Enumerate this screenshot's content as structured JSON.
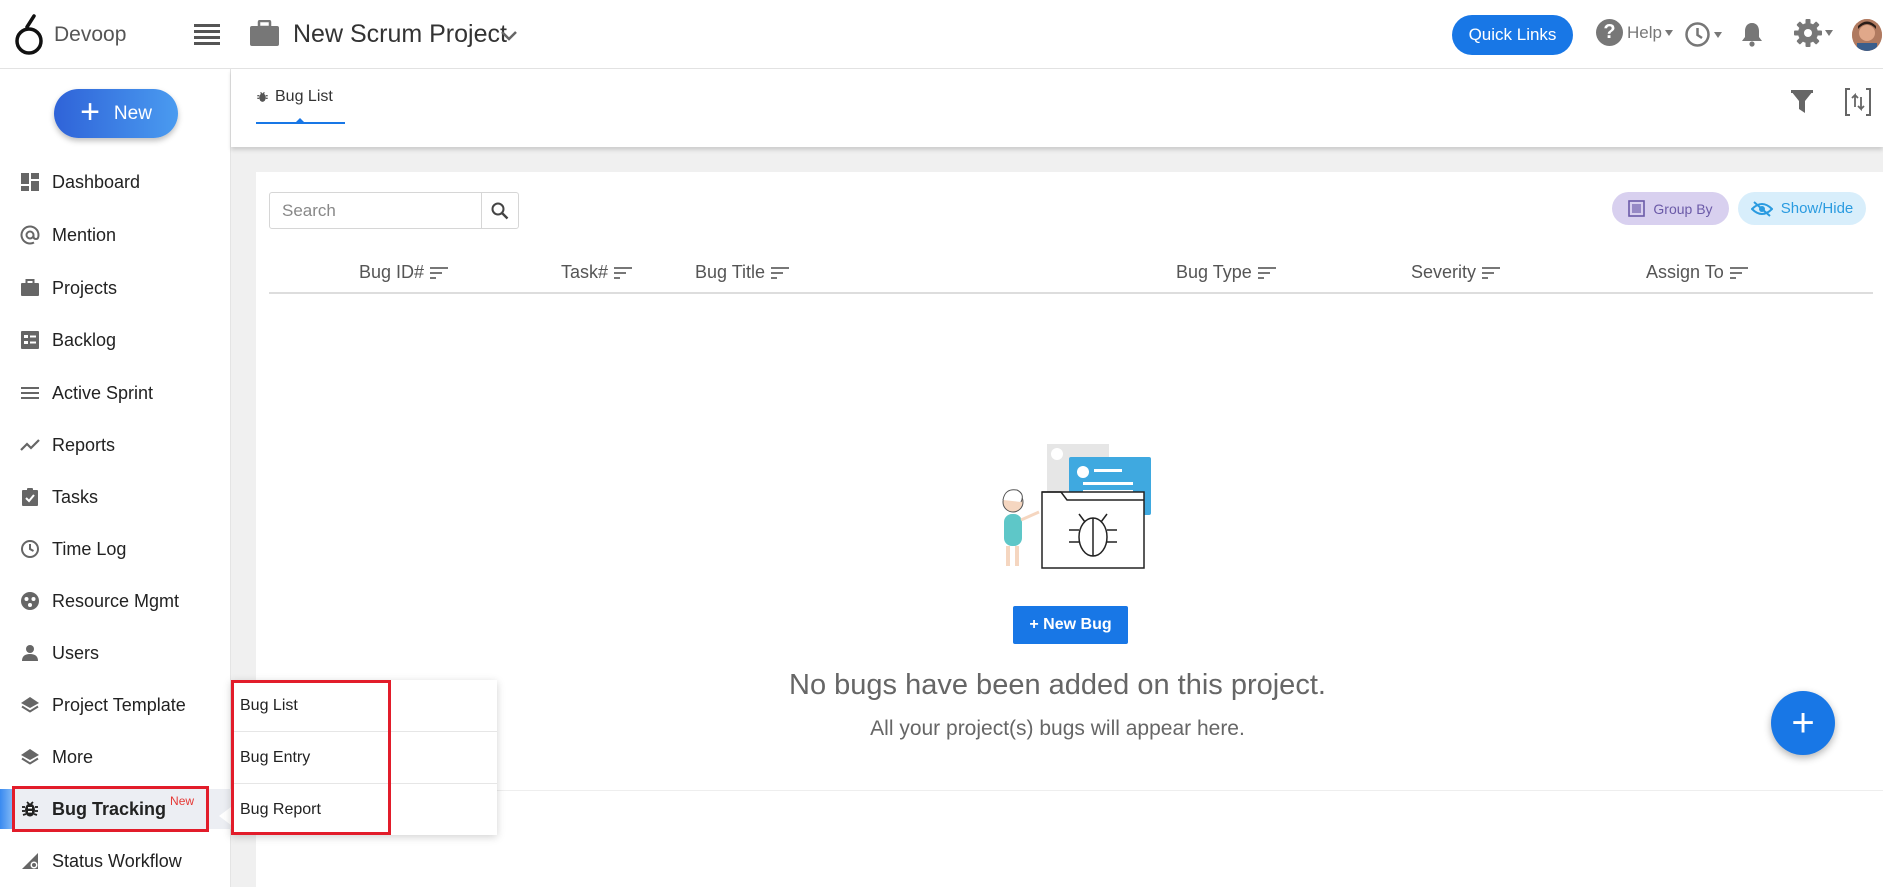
{
  "brand": {
    "name": "Devoop"
  },
  "header": {
    "project_name": "New Scrum Project",
    "quick_links": "Quick Links",
    "help": "Help"
  },
  "sidebar": {
    "new_label": "New",
    "items": [
      {
        "label": "Dashboard",
        "icon": "dashboard-icon"
      },
      {
        "label": "Mention",
        "icon": "at-icon"
      },
      {
        "label": "Projects",
        "icon": "briefcase-icon"
      },
      {
        "label": "Backlog",
        "icon": "backlog-icon"
      },
      {
        "label": "Active Sprint",
        "icon": "sprint-icon"
      },
      {
        "label": "Reports",
        "icon": "trend-icon"
      },
      {
        "label": "Tasks",
        "icon": "clipboard-check-icon"
      },
      {
        "label": "Time Log",
        "icon": "clock-icon"
      },
      {
        "label": "Resource Mgmt",
        "icon": "resource-icon"
      },
      {
        "label": "Users",
        "icon": "user-icon"
      },
      {
        "label": "Project Template",
        "icon": "layers-icon"
      },
      {
        "label": "More",
        "icon": "layers-icon"
      },
      {
        "label": "Bug Tracking",
        "icon": "bug-icon",
        "badge": "New"
      },
      {
        "label": "Status Workflow",
        "icon": "workflow-icon"
      }
    ]
  },
  "flyout": {
    "items": [
      "Bug List",
      "Bug Entry",
      "Bug Report"
    ]
  },
  "tabs": {
    "active": "Bug List"
  },
  "toolbar": {
    "search_placeholder": "Search",
    "group_by": "Group By",
    "show_hide": "Show/Hide"
  },
  "table": {
    "columns": [
      "Bug ID#",
      "Task#",
      "Bug Title",
      "Bug Type",
      "Severity",
      "Assign To"
    ]
  },
  "empty_state": {
    "button": "+ New Bug",
    "title": "No bugs have been added on this project.",
    "subtitle": "All your project(s) bugs will appear here."
  },
  "colors": {
    "primary": "#1877e6",
    "highlight_box": "#e21c2a",
    "group_by_bg": "#d8d0ef",
    "show_hide_bg": "#d8eefb"
  }
}
